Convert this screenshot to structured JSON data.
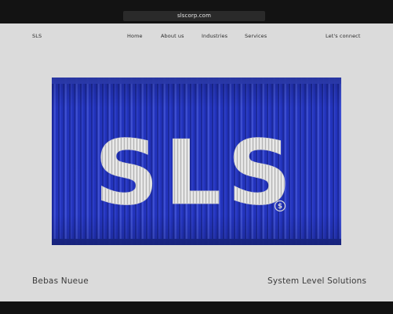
{
  "browser": {
    "url": "slscorp.com"
  },
  "nav": {
    "brand": "SLS",
    "items": [
      "Home",
      "About us",
      "Industries",
      "Services"
    ],
    "cta": "Let's connect"
  },
  "hero": {
    "logo_text": "SLS",
    "mark_symbol": "$",
    "container_color": "#2334bf",
    "logo_color": "#d9d9d9"
  },
  "footer": {
    "left": "Bebas Nueue",
    "right": "System Level Solutions"
  }
}
